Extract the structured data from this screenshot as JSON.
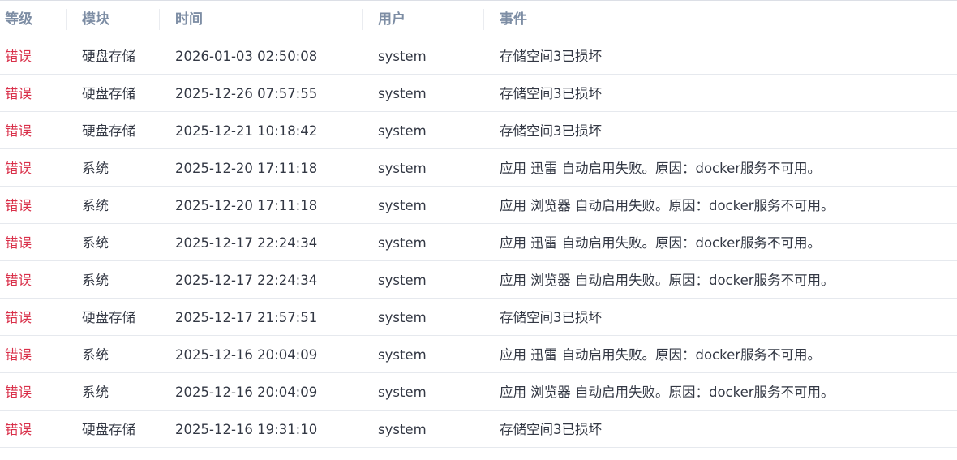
{
  "colors": {
    "header_text": "#7d8da4",
    "error_level": "#d9304a",
    "cell_text": "#333844",
    "row_border": "#e6e9ee"
  },
  "columns": {
    "level": "等级",
    "module": "模块",
    "time": "时间",
    "user": "用户",
    "event": "事件"
  },
  "rows": [
    {
      "level": "错误",
      "module": "硬盘存储",
      "time": "2026-01-03 02:50:08",
      "user": "system",
      "event": "存储空间3已损坏"
    },
    {
      "level": "错误",
      "module": "硬盘存储",
      "time": "2025-12-26 07:57:55",
      "user": "system",
      "event": "存储空间3已损坏"
    },
    {
      "level": "错误",
      "module": "硬盘存储",
      "time": "2025-12-21 10:18:42",
      "user": "system",
      "event": "存储空间3已损坏"
    },
    {
      "level": "错误",
      "module": "系统",
      "time": "2025-12-20 17:11:18",
      "user": "system",
      "event": "应用 迅雷 自动启用失败。原因：docker服务不可用。"
    },
    {
      "level": "错误",
      "module": "系统",
      "time": "2025-12-20 17:11:18",
      "user": "system",
      "event": "应用 浏览器 自动启用失败。原因：docker服务不可用。"
    },
    {
      "level": "错误",
      "module": "系统",
      "time": "2025-12-17 22:24:34",
      "user": "system",
      "event": "应用 迅雷 自动启用失败。原因：docker服务不可用。"
    },
    {
      "level": "错误",
      "module": "系统",
      "time": "2025-12-17 22:24:34",
      "user": "system",
      "event": "应用 浏览器 自动启用失败。原因：docker服务不可用。"
    },
    {
      "level": "错误",
      "module": "硬盘存储",
      "time": "2025-12-17 21:57:51",
      "user": "system",
      "event": "存储空间3已损坏"
    },
    {
      "level": "错误",
      "module": "系统",
      "time": "2025-12-16 20:04:09",
      "user": "system",
      "event": "应用 迅雷 自动启用失败。原因：docker服务不可用。"
    },
    {
      "level": "错误",
      "module": "系统",
      "time": "2025-12-16 20:04:09",
      "user": "system",
      "event": "应用 浏览器 自动启用失败。原因：docker服务不可用。"
    },
    {
      "level": "错误",
      "module": "硬盘存储",
      "time": "2025-12-16 19:31:10",
      "user": "system",
      "event": "存储空间3已损坏"
    }
  ]
}
